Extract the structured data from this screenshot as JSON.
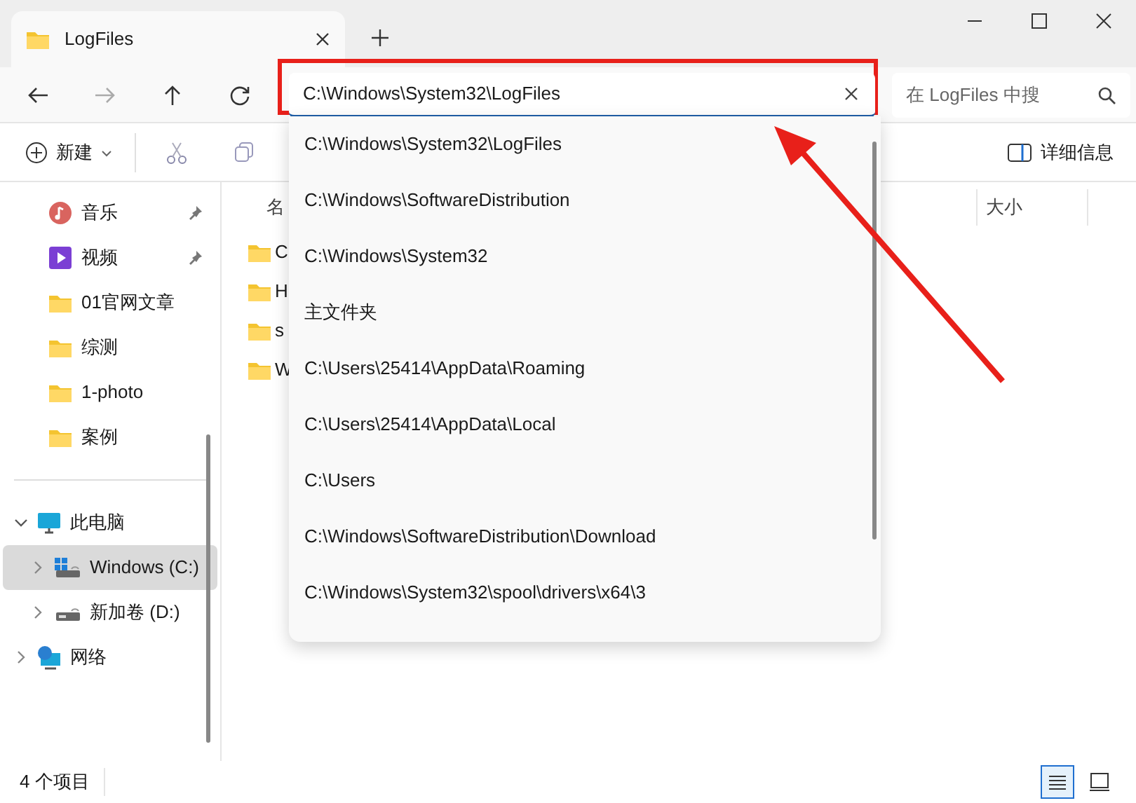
{
  "tab": {
    "title": "LogFiles"
  },
  "address": {
    "value": "C:\\Windows\\System32\\LogFiles",
    "highlighted": true
  },
  "search": {
    "placeholder": "在 LogFiles 中搜"
  },
  "suggestions": [
    {
      "text": "C:\\Windows\\System32\\LogFiles"
    },
    {
      "text": "C:\\Windows\\SoftwareDistribution"
    },
    {
      "text": "C:\\Windows\\System32"
    },
    {
      "text": "主文件夹"
    },
    {
      "text": "C:\\Users\\25414\\AppData\\Roaming"
    },
    {
      "text": "C:\\Users\\25414\\AppData\\Local"
    },
    {
      "text": "C:\\Users"
    },
    {
      "text": "C:\\Windows\\SoftwareDistribution\\Download"
    },
    {
      "text": "C:\\Windows\\System32\\spool\\drivers\\x64\\3"
    }
  ],
  "toolbar": {
    "new_label": "新建",
    "details_label": "详细信息"
  },
  "sidebar": {
    "quick_access": [
      {
        "label": "音乐",
        "kind": "music",
        "pinned": true
      },
      {
        "label": "视频",
        "kind": "video",
        "pinned": true
      },
      {
        "label": "01官网文章",
        "kind": "folder",
        "pinned": false
      },
      {
        "label": "综测",
        "kind": "folder",
        "pinned": false
      },
      {
        "label": "1-photo",
        "kind": "folder",
        "pinned": false
      },
      {
        "label": "案例",
        "kind": "folder",
        "pinned": false
      }
    ],
    "tree": [
      {
        "label": "此电脑",
        "kind": "pc",
        "expanded": true,
        "selected": false,
        "children": [
          {
            "label": "Windows (C:)",
            "kind": "windrive",
            "expanded": false,
            "selected": true
          },
          {
            "label": "新加卷 (D:)",
            "kind": "drive",
            "expanded": false,
            "selected": false
          }
        ]
      },
      {
        "label": "网络",
        "kind": "network",
        "expanded": false,
        "selected": false
      }
    ]
  },
  "columns": [
    "名",
    "大小"
  ],
  "files": [
    "C",
    "H",
    "s",
    "W"
  ],
  "status_bar": {
    "count": "4 个项目",
    "views": [
      {
        "kind": "details",
        "selected": true
      },
      {
        "kind": "tiles",
        "selected": false
      }
    ]
  }
}
